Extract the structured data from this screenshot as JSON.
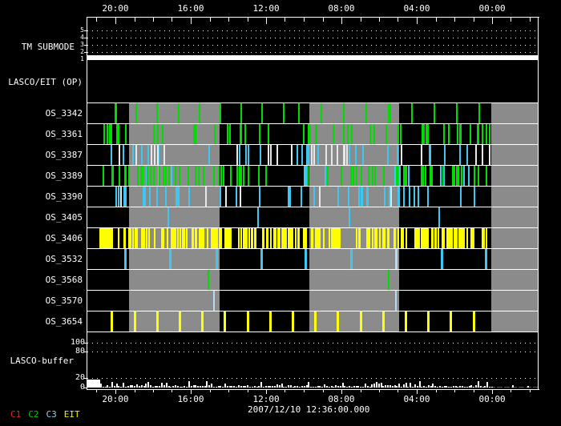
{
  "window": {
    "background": "#000000"
  },
  "colors": {
    "axis": "#ffffff",
    "gray_band": "#8b8b8b",
    "green": "#00dc00",
    "cyan": "#3cc8f0",
    "pale": "#b4dcf0",
    "white": "#e8e8e8",
    "yellow": "#ffff00",
    "red": "#dc1e1e"
  },
  "panels": {
    "tm_submode": {
      "label": "TM SUBMODE",
      "y_tick_labels": [
        "5",
        "4",
        "3",
        "2",
        "1"
      ],
      "current_value": 1
    },
    "lasco_eit": {
      "label": "LASCO/EIT (OP)"
    },
    "lasco_buffer": {
      "label": "LASCO-buffer",
      "y_tick_labels": [
        "100",
        "80",
        "20",
        "0"
      ]
    }
  },
  "footer": {
    "date_label": "2007/12/10 12:36:00.000",
    "legend": [
      {
        "label": "C1",
        "color": "#dd2a2a"
      },
      {
        "label": "C2",
        "color": "#00cc00"
      },
      {
        "label": "C3",
        "color": "#9cccf0"
      },
      {
        "label": "EIT",
        "color": "#f0f000"
      }
    ]
  },
  "chart_data": {
    "type": "timeline",
    "title": "",
    "x_axis": {
      "labels": [
        "20:00",
        "16:00",
        "12:00",
        "08:00",
        "04:00",
        "00:00"
      ],
      "label_positions_pct": [
        6.38,
        23.05,
        39.72,
        56.38,
        73.05,
        89.72
      ],
      "minor_ticks_pct": [
        2.21,
        10.55,
        14.72,
        18.88,
        27.22,
        31.38,
        35.55,
        43.88,
        48.05,
        52.22,
        60.55,
        64.72,
        68.88,
        77.22,
        81.38,
        85.55,
        93.88,
        98.05
      ],
      "date": "2007/12/10 12:36:00.000",
      "shown_on": "top and bottom"
    },
    "gray_bands_pct": [
      [
        9.4,
        29.4
      ],
      [
        49.3,
        69.1
      ],
      [
        89.5,
        100
      ]
    ],
    "tm_submode": {
      "value": 1,
      "levels": [
        1,
        2,
        3,
        4,
        5
      ],
      "gridline_levels": [
        5,
        4,
        3,
        2
      ],
      "bar_extent_pct": [
        0,
        100
      ]
    },
    "lasco_eit_events": [],
    "rows": [
      {
        "label": "OS_3342",
        "ticks": {
          "mode": "list",
          "color": "green",
          "items": [
            [
              6.2,
              3
            ],
            [
              10.8,
              2
            ],
            [
              15.4,
              2
            ],
            [
              20.2,
              2
            ],
            [
              24.8,
              2
            ],
            [
              29.4,
              2
            ],
            [
              34.0,
              2
            ],
            [
              38.7,
              2
            ],
            [
              43.4,
              2
            ],
            [
              46.8,
              2
            ],
            [
              51.8,
              2
            ],
            [
              56.7,
              2
            ],
            [
              61.7,
              2
            ],
            [
              66.7,
              4
            ],
            [
              71.8,
              2
            ],
            [
              76.8,
              2
            ],
            [
              81.7,
              2
            ],
            [
              86.7,
              2
            ]
          ]
        }
      },
      {
        "label": "OS_3361",
        "ticks": {
          "mode": "random",
          "seed": 7,
          "start": 3.2,
          "end": 89.4,
          "count": 52,
          "width": 2,
          "palette": [
            [
              "green",
              1
            ]
          ]
        }
      },
      {
        "label": "OS_3387",
        "ticks": {
          "mode": "random",
          "seed": 11,
          "start": 3.2,
          "end": 89.4,
          "count": 55,
          "width": 2,
          "palette": [
            [
              "cyan",
              0.55
            ],
            [
              "white",
              0.45
            ]
          ]
        }
      },
      {
        "label": "OS_3389",
        "ticks": {
          "mode": "random",
          "seed": 13,
          "start": 3.0,
          "end": 89.4,
          "count": 95,
          "width": 2,
          "palette": [
            [
              "green",
              0.85
            ],
            [
              "cyan",
              0.15
            ]
          ]
        }
      },
      {
        "label": "OS_3390",
        "ticks": {
          "mode": "random",
          "seed": 17,
          "start": 3.0,
          "end": 89.4,
          "count": 44,
          "width": 2,
          "palette": [
            [
              "cyan",
              0.8
            ],
            [
              "white",
              0.2
            ]
          ]
        }
      },
      {
        "label": "OS_3405",
        "ticks": {
          "mode": "list",
          "color": "cyan",
          "items": [
            [
              17.9,
              2
            ],
            [
              37.8,
              2
            ],
            [
              58.0,
              2
            ],
            [
              77.8,
              2
            ]
          ]
        }
      },
      {
        "label": "OS_3406",
        "ticks": {
          "mode": "random",
          "seed": 19,
          "start": 2.8,
          "end": 88.7,
          "count": 235,
          "width": 2,
          "palette": [
            [
              "yellow",
              1
            ]
          ]
        }
      },
      {
        "label": "OS_3532",
        "ticks": {
          "mode": "list",
          "color": "cyan",
          "items": [
            [
              8.4,
              3
            ],
            [
              18.2,
              3
            ],
            [
              28.6,
              3
            ],
            [
              38.5,
              3
            ],
            [
              48.2,
              3
            ],
            [
              58.3,
              3
            ],
            [
              68.3,
              3,
              "pale"
            ],
            [
              78.4,
              3
            ],
            [
              88.1,
              3
            ]
          ]
        }
      },
      {
        "label": "OS_3568",
        "ticks": {
          "mode": "list",
          "color": "green",
          "items": [
            [
              26.8,
              2
            ],
            [
              66.7,
              2
            ]
          ]
        }
      },
      {
        "label": "OS_3570",
        "ticks": {
          "mode": "list",
          "color": "pale",
          "items": [
            [
              28.1,
              2
            ],
            [
              68.3,
              2
            ]
          ]
        }
      },
      {
        "label": "OS_3654",
        "ticks": {
          "mode": "list",
          "color": "yellow",
          "items": [
            [
              5.4,
              3
            ],
            [
              10.4,
              3
            ],
            [
              15.4,
              3
            ],
            [
              20.4,
              3
            ],
            [
              25.4,
              3
            ],
            [
              30.4,
              3
            ],
            [
              35.4,
              3
            ],
            [
              40.4,
              3
            ],
            [
              45.4,
              3
            ],
            [
              50.4,
              3
            ],
            [
              55.4,
              3
            ],
            [
              60.4,
              3
            ],
            [
              65.4,
              3
            ],
            [
              70.4,
              3
            ],
            [
              75.4,
              3
            ],
            [
              80.4,
              3
            ],
            [
              85.4,
              3
            ]
          ]
        }
      }
    ],
    "buffer": {
      "ylabel": "LASCO-buffer",
      "ylim": [
        0,
        130
      ],
      "y_ticks": [
        100,
        80,
        20,
        0
      ],
      "gridlines": [
        100,
        80,
        20
      ],
      "signal": {
        "mode": "noise",
        "seed": 23,
        "step_pct": 0.5,
        "initial_block": {
          "start_pct": 0,
          "end_pct": 3.0,
          "value": 18
        },
        "active_end_pct": 89.5,
        "base": 1.5,
        "jitter": 3.5,
        "spike_prob": 0.22,
        "spike_max": 11,
        "blips": [
          [
            94.2,
            5
          ],
          [
            97.6,
            3
          ]
        ]
      },
      "limit_line": {
        "value": 1,
        "color": "red",
        "start_pct": 3.0,
        "dashed": true
      }
    }
  }
}
